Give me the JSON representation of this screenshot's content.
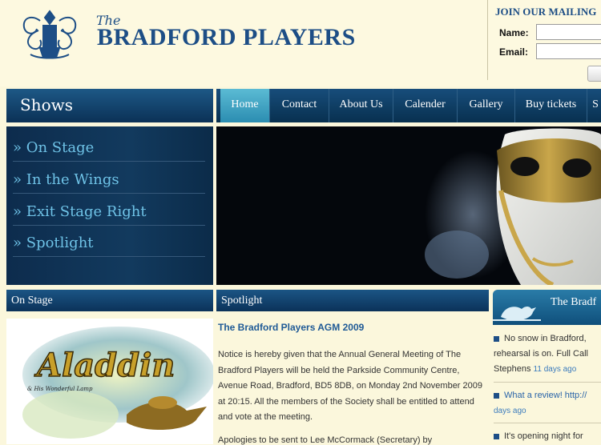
{
  "header": {
    "brand_the": "The",
    "brand_name": "BRADFORD PLAYERS",
    "mailing_title": "JOIN OUR MAILING",
    "name_label": "Name:",
    "email_label": "Email:"
  },
  "shows": {
    "title": "Shows",
    "items": [
      {
        "label": "» On Stage"
      },
      {
        "label": "» In the Wings"
      },
      {
        "label": "» Exit Stage Right"
      },
      {
        "label": "» Spotlight"
      }
    ]
  },
  "nav": {
    "items": [
      {
        "label": "Home"
      },
      {
        "label": "Contact"
      },
      {
        "label": "About Us"
      },
      {
        "label": "Calender"
      },
      {
        "label": "Gallery"
      },
      {
        "label": "Buy tickets"
      },
      {
        "label": "S"
      }
    ]
  },
  "sections": {
    "on_stage": "On Stage",
    "spotlight": "Spotlight"
  },
  "aladdin": {
    "title": "Aladdin",
    "subtitle": "& His Wonderful Lamp"
  },
  "spotlight": {
    "headline": "The Bradford Players AGM 2009",
    "body": "Notice is hereby given that the Annual General Meeting of The Bradford Players will be held the Parkside Community Centre, Avenue Road, Bradford, BD5 8DB, on Monday 2nd November 2009 at 20:15.  All the members of the Society shall be entitled to attend and vote at the meeting.",
    "body2": "Apologies to be sent to Lee McCormack (Secretary) by"
  },
  "twitter": {
    "title": "The Bradf",
    "tweets": [
      {
        "text": "No snow in Bradford, rehearsal is on. Full Call Stephens",
        "time": "11 days ago"
      },
      {
        "text": "What a review! http://",
        "time": "days ago"
      },
      {
        "text": "It's opening night for",
        "time": ""
      }
    ]
  },
  "colors": {
    "brand_blue": "#1d4e86",
    "page_bg": "#fbf7dc",
    "nav_dark": "#08304f",
    "menu_link": "#6ec2e6",
    "active_tab": "#2b8db1"
  }
}
